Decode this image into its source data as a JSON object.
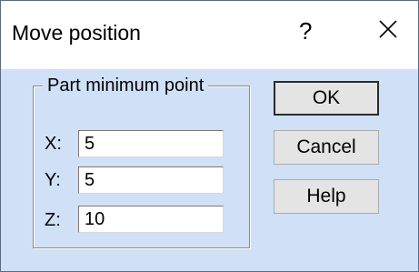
{
  "window": {
    "title": "Move position",
    "help_glyph": "?",
    "close_icon": "close-icon"
  },
  "group": {
    "title": "Part minimum point",
    "fields": [
      {
        "label": "X:",
        "value": "5"
      },
      {
        "label": "Y:",
        "value": "5"
      },
      {
        "label": "Z:",
        "value": "10"
      }
    ]
  },
  "buttons": {
    "ok": "OK",
    "cancel": "Cancel",
    "help": "Help"
  },
  "colors": {
    "client_background": "#cfe0f7",
    "title_background": "#ffffff"
  }
}
